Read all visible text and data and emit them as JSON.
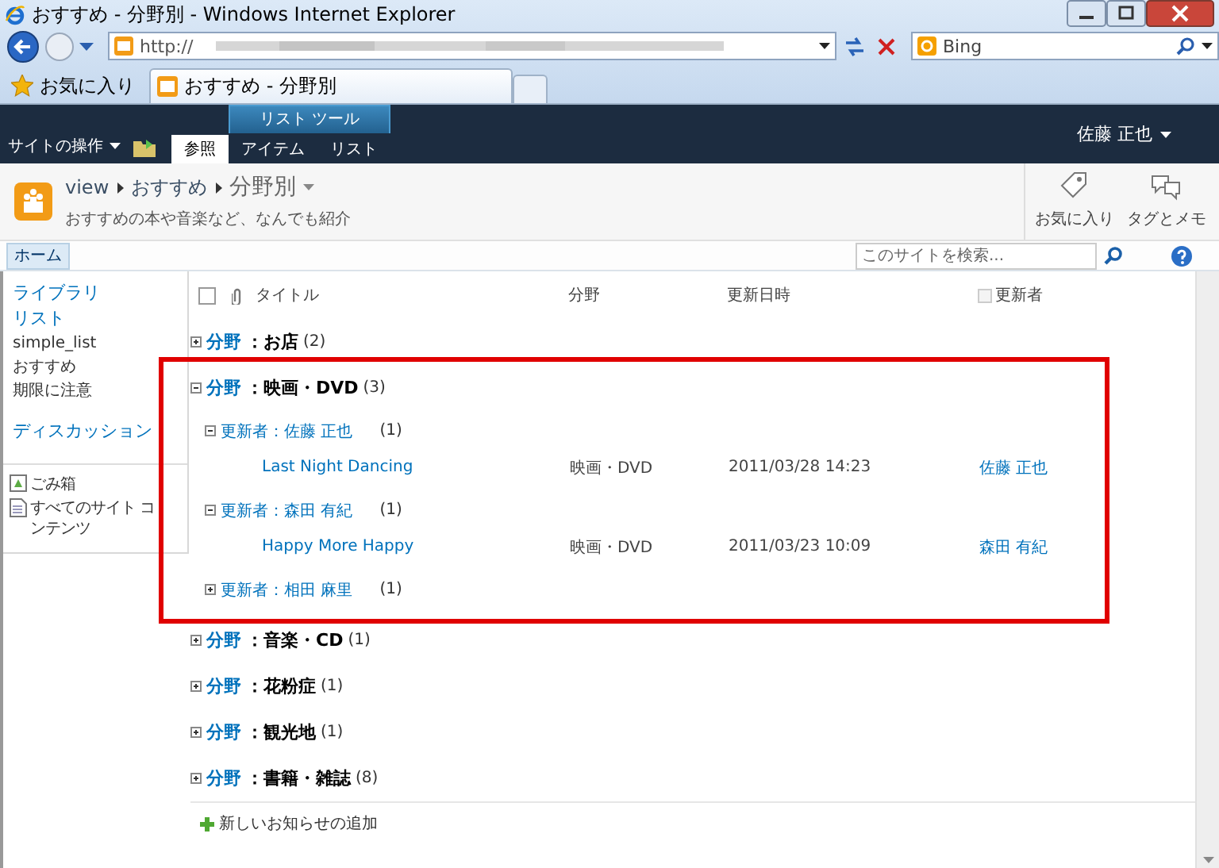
{
  "browser": {
    "title": "おすすめ - 分野別 - Windows Internet Explorer",
    "address": "http://",
    "search_engine": "Bing",
    "favorites_label": "お気に入り",
    "tab_title": "おすすめ - 分野別"
  },
  "ribbon": {
    "site_actions": "サイトの操作",
    "tool_group": "リスト ツール",
    "tabs": [
      {
        "label": "参照",
        "selected": true
      },
      {
        "label": "アイテム",
        "selected": false
      },
      {
        "label": "リスト",
        "selected": false
      }
    ],
    "user": "佐藤 正也"
  },
  "title_area": {
    "breadcrumb": [
      "view",
      "おすすめ"
    ],
    "current": "分野別",
    "description": "おすすめの本や音楽など、なんでも紹介",
    "actions": [
      {
        "label": "お気に入り"
      },
      {
        "label": "タグとメモ"
      }
    ]
  },
  "top_nav": {
    "home": "ホーム",
    "search": {
      "placeholder": "このサイトを検索..."
    }
  },
  "quick_launch": {
    "items": [
      {
        "label": "ライブラリ",
        "kind": "heading"
      },
      {
        "label": "リスト",
        "kind": "heading"
      },
      {
        "label": "simple_list",
        "kind": "link"
      },
      {
        "label": "おすすめ",
        "kind": "link"
      },
      {
        "label": "期限に注意",
        "kind": "link"
      },
      {
        "label": "ディスカッション",
        "kind": "heading"
      }
    ],
    "bottom": [
      {
        "label": "ごみ箱",
        "kind": "recycle"
      },
      {
        "label": "すべてのサイト コンテンツ",
        "kind": "content"
      }
    ]
  },
  "list": {
    "header_checkbox": {
      "checked": false
    },
    "columns": [
      "タイトル",
      "分野",
      "更新日時",
      "更新者"
    ],
    "groups": [
      {
        "field": "分野",
        "value": "：お店",
        "count": "(2)",
        "expanded": false
      },
      {
        "field": "分野",
        "value": "：映画・DVD",
        "count": "(3)",
        "expanded": true,
        "children": [
          {
            "label": "更新者：佐藤 正也",
            "count": "(1)",
            "expanded": true,
            "rows": [
              {
                "title": "Last Night Dancing",
                "category": "映画・DVD",
                "modified": "2011/03/28 14:23",
                "modified_by": "佐藤 正也"
              }
            ]
          },
          {
            "label": "更新者：森田 有紀",
            "count": "(1)",
            "expanded": true,
            "rows": [
              {
                "title": "Happy More Happy",
                "category": "映画・DVD",
                "modified": "2011/03/23 10:09",
                "modified_by": "森田 有紀"
              }
            ]
          },
          {
            "label": "更新者：相田 麻里",
            "count": "(1)",
            "expanded": false
          }
        ]
      },
      {
        "field": "分野",
        "value": "：音楽・CD",
        "count": "(1)",
        "expanded": false
      },
      {
        "field": "分野",
        "value": "：花粉症",
        "count": "(1)",
        "expanded": false
      },
      {
        "field": "分野",
        "value": "：観光地",
        "count": "(1)",
        "expanded": false
      },
      {
        "field": "分野",
        "value": "：書籍・雑誌",
        "count": "(8)",
        "expanded": false
      }
    ],
    "add_link": "新しいお知らせの追加"
  }
}
